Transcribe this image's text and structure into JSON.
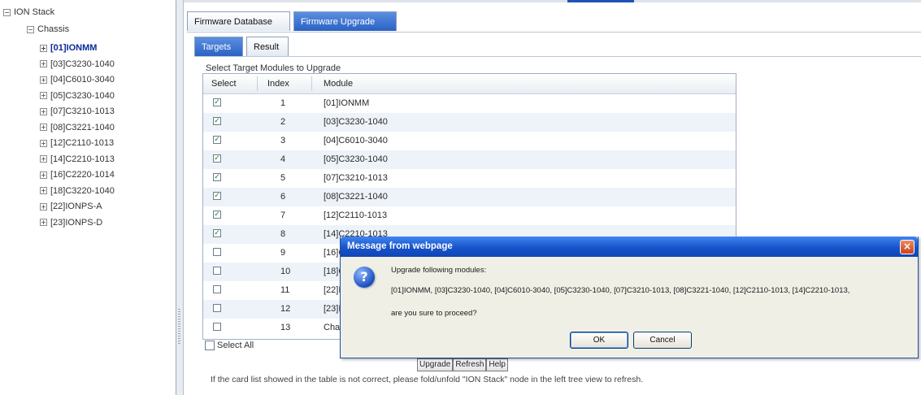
{
  "tree": {
    "root": "ION Stack",
    "chassis": "Chassis",
    "items": [
      "[01]IONMM",
      "[03]C3230-1040",
      "[04]C6010-3040",
      "[05]C3230-1040",
      "[07]C3210-1013",
      "[08]C3221-1040",
      "[12]C2110-1013",
      "[14]C2210-1013",
      "[16]C2220-1014",
      "[18]C3220-1040",
      "[22]IONPS-A",
      "[23]IONPS-D"
    ],
    "selected_index": 0
  },
  "tabs": {
    "primary": [
      "Firmware Database",
      "Firmware Upgrade"
    ],
    "primary_active": 1,
    "secondary": [
      "Targets",
      "Result"
    ],
    "secondary_active": 0
  },
  "panel": {
    "title": "Select Target Modules to Upgrade",
    "columns": [
      "Select",
      "Index",
      "Module"
    ],
    "rows": [
      {
        "checked": true,
        "index": "1",
        "module": "[01]IONMM"
      },
      {
        "checked": true,
        "index": "2",
        "module": "[03]C3230-1040"
      },
      {
        "checked": true,
        "index": "3",
        "module": "[04]C6010-3040"
      },
      {
        "checked": true,
        "index": "4",
        "module": "[05]C3230-1040"
      },
      {
        "checked": true,
        "index": "5",
        "module": "[07]C3210-1013"
      },
      {
        "checked": true,
        "index": "6",
        "module": "[08]C3221-1040"
      },
      {
        "checked": true,
        "index": "7",
        "module": "[12]C2110-1013"
      },
      {
        "checked": true,
        "index": "8",
        "module": "[14]C2210-1013"
      },
      {
        "checked": false,
        "index": "9",
        "module": "[16]C2220-1014"
      },
      {
        "checked": false,
        "index": "10",
        "module": "[18]C3220-1040"
      },
      {
        "checked": false,
        "index": "11",
        "module": "[22]IONPS-A"
      },
      {
        "checked": false,
        "index": "12",
        "module": "[23]IONPS-D"
      },
      {
        "checked": false,
        "index": "13",
        "module": "Chassis"
      }
    ],
    "select_all": "Select All",
    "buttons": {
      "upgrade": "Upgrade",
      "refresh": "Refresh",
      "help": "Help"
    },
    "note": "If the card list showed in the table is not correct, please fold/unfold \"ION Stack\" node in the left tree view to refresh."
  },
  "dialog": {
    "title": "Message from webpage",
    "line1": "Upgrade following modules:",
    "line2": "[01]IONMM, [03]C3230-1040, [04]C6010-3040, [05]C3230-1040, [07]C3210-1013, [08]C3221-1040, [12]C2110-1013, [14]C2210-1013,",
    "line3": "are you sure to proceed?",
    "ok": "OK",
    "cancel": "Cancel"
  }
}
